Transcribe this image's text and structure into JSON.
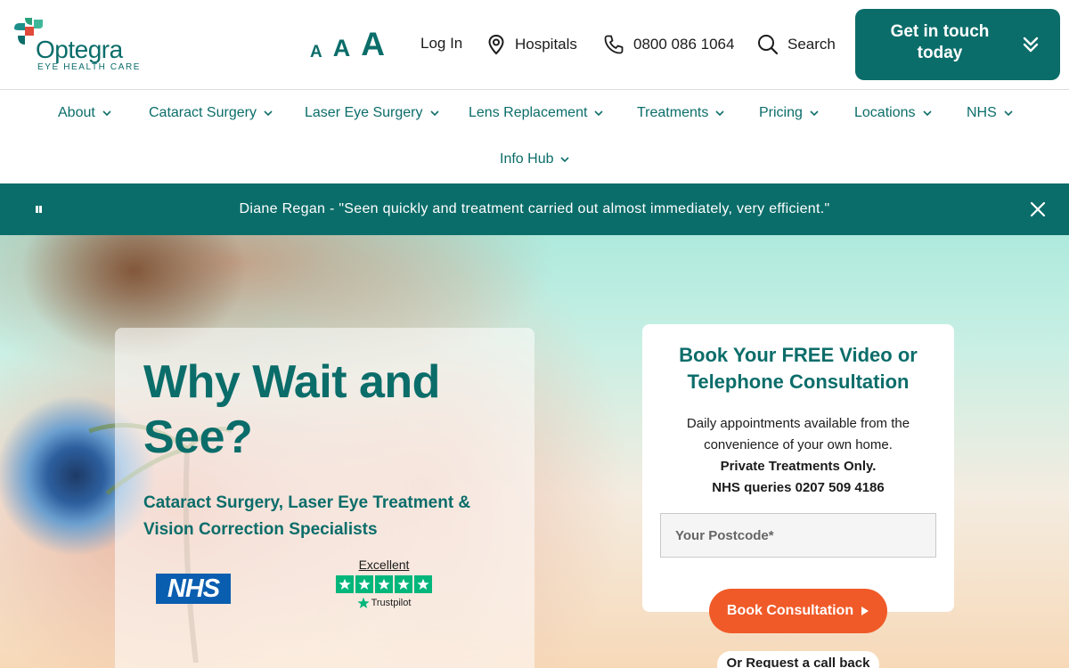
{
  "brand": {
    "name": "Optegra",
    "tagline": "EYE HEALTH CARE"
  },
  "header": {
    "font_sizes": [
      "A",
      "A",
      "A"
    ],
    "login": "Log In",
    "hospitals": "Hospitals",
    "phone": "0800 086 1064",
    "search": "Search",
    "cta": "Get in touch today"
  },
  "nav": {
    "items": [
      {
        "label": "About"
      },
      {
        "label": "Cataract Surgery"
      },
      {
        "label": "Laser Eye Surgery"
      },
      {
        "label": "Lens Replacement"
      },
      {
        "label": "Treatments"
      },
      {
        "label": "Pricing"
      },
      {
        "label": "Locations"
      },
      {
        "label": "NHS"
      },
      {
        "label": "Info Hub"
      }
    ]
  },
  "testimonial": {
    "text": "Diane Regan - \"Seen quickly and treatment carried out almost immediately, very efficient.\""
  },
  "hero": {
    "title": "Why Wait and See?",
    "subtitle": "Cataract Surgery, Laser Eye Treatment & Vision Correction Specialists",
    "nhs_logo": "NHS",
    "trustpilot": {
      "rating_label": "Excellent",
      "stars": 5,
      "brand": "Trustpilot"
    }
  },
  "consultation": {
    "title": "Book Your FREE Video or Telephone Consultation",
    "text": "Daily appointments available from the convenience of your own home.",
    "private_note": "Private Treatments Only.",
    "nhs_note": "NHS queries 0207 509 4186",
    "postcode_placeholder": "Your Postcode*",
    "book_button": "Book Consultation",
    "callback": "Or Request a call back"
  },
  "colors": {
    "brand_teal": "#0b6d6a",
    "accent_orange": "#f05a28",
    "trustpilot_green": "#00b67a",
    "nhs_blue": "#0a5eb0"
  }
}
